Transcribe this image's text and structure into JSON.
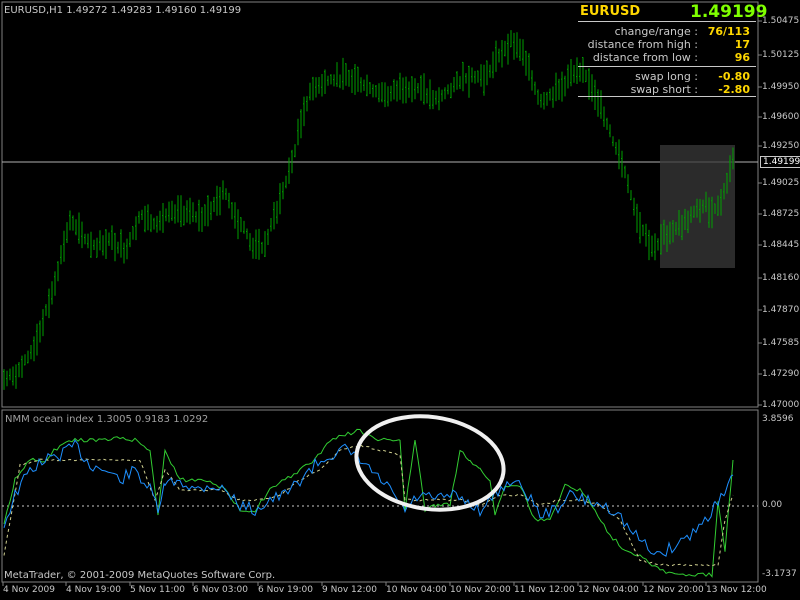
{
  "chart_header": "EURUSD,H1  1.49272 1.49283 1.49160 1.49199",
  "panel": {
    "symbol": "EURUSD",
    "price": "1.49199",
    "rows": [
      {
        "label": "change/range :",
        "value": "76/113"
      },
      {
        "label": "distance from high :",
        "value": "17"
      },
      {
        "label": "distance from low :",
        "value": "96"
      },
      {
        "label": "swap long :",
        "value": "-0.80"
      },
      {
        "label": "swap short :",
        "value": "-2.80"
      }
    ]
  },
  "price_axis": [
    "1.50475",
    "1.50125",
    "1.49950",
    "1.49600",
    "1.49250",
    "1.49025",
    "1.48725",
    "1.48445",
    "1.48160",
    "1.47870",
    "1.47585",
    "1.47290",
    "1.47000"
  ],
  "current_price_tag": "1.49199",
  "indicator": {
    "title": "NMM ocean index 1.3005 0.9183 1.0292",
    "axis": [
      "3.8596",
      "0.00",
      "-3.1737"
    ]
  },
  "copyright": "MetaTrader, © 2001-2009 MetaQuotes Software Corp.",
  "time_axis": [
    "4 Nov 2009",
    "4 Nov 19:00",
    "5 Nov 11:00",
    "6 Nov 03:00",
    "6 Nov 19:00",
    "9 Nov 12:00",
    "10 Nov 04:00",
    "10 Nov 20:00",
    "11 Nov 12:00",
    "12 Nov 04:00",
    "12 Nov 20:00",
    "13 Nov 12:00"
  ],
  "colors": {
    "bars": "#00a000",
    "grid": "#808080",
    "line_main": "#1e90ff",
    "line_green": "#32cd32",
    "panel_value": "#ffd700",
    "symbol": "#ffd700",
    "big_price": "#7fff00"
  }
}
